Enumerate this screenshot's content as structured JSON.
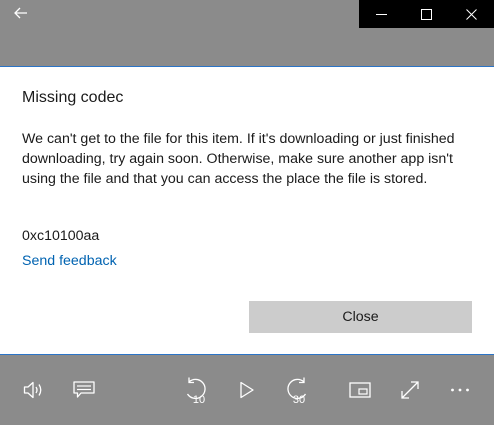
{
  "dialog": {
    "title": "Missing codec",
    "message": "We can't get to the file for this item. If it's downloading or just finished downloading, try again soon. Otherwise, make sure another app isn't using the file and that you can access the place the file is stored.",
    "error_code": "0xc10100aa",
    "feedback_link": "Send feedback",
    "close_label": "Close"
  },
  "controls": {
    "skip_back_seconds": "10",
    "skip_forward_seconds": "30"
  },
  "colors": {
    "accent": "#0063b1",
    "dialog_border": "#2b74c7",
    "dim_overlay": "#8b8b8b",
    "close_button": "#cccccc"
  },
  "icons": [
    "back-arrow-icon",
    "minimize-icon",
    "maximize-icon",
    "close-icon",
    "volume-icon",
    "subtitles-icon",
    "skip-back-icon",
    "play-icon",
    "skip-forward-icon",
    "mini-view-icon",
    "fullscreen-icon",
    "more-icon"
  ]
}
